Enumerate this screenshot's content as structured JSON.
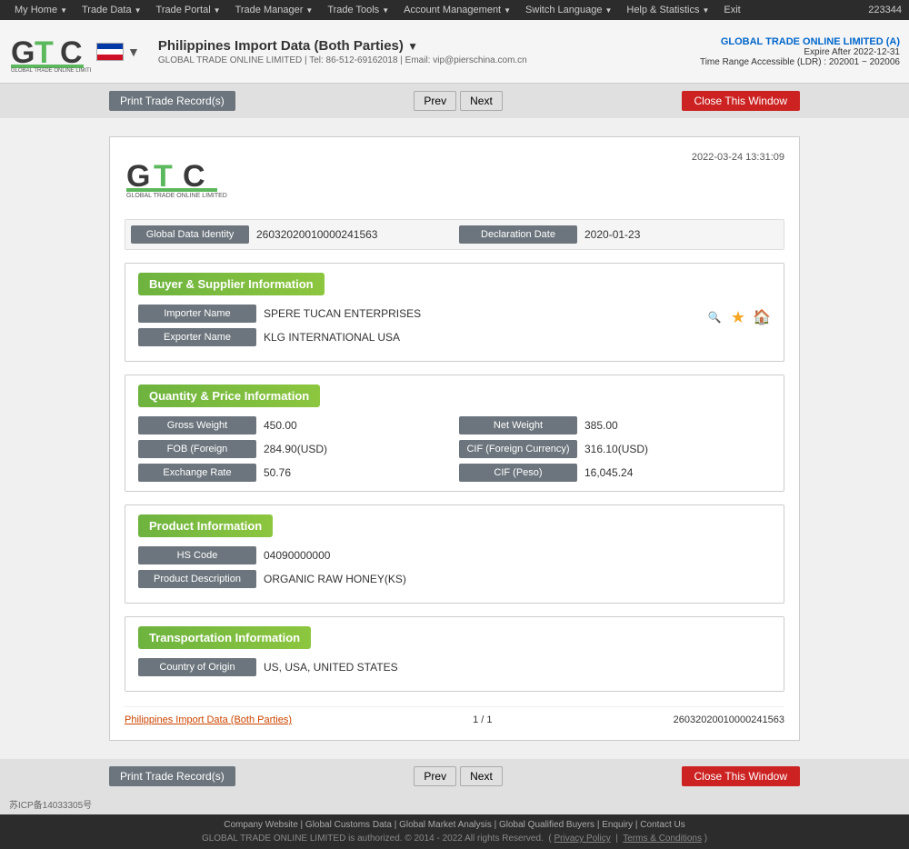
{
  "topnav": {
    "items": [
      "My Home",
      "Trade Data",
      "Trade Portal",
      "Trade Manager",
      "Trade Tools",
      "Account Management",
      "Switch Language",
      "Help & Statistics",
      "Exit"
    ],
    "user_id": "223344"
  },
  "header": {
    "title": "Philippines Import Data (Both Parties)",
    "subtitle": "GLOBAL TRADE ONLINE LIMITED | Tel: 86-512-69162018 | Email: vip@pierschina.com.cn",
    "company": "GLOBAL TRADE ONLINE LIMITED (A)",
    "expire": "Expire After 2022-12-31",
    "range": "Time Range Accessible (LDR) : 202001 ~ 202006"
  },
  "toolbar": {
    "print_label": "Print Trade Record(s)",
    "prev_label": "Prev",
    "next_label": "Next",
    "close_label": "Close This Window"
  },
  "card": {
    "datetime": "2022-03-24 13:31:09",
    "global_data_identity_label": "Global Data Identity",
    "global_data_identity_value": "26032020010000241563",
    "declaration_date_label": "Declaration Date",
    "declaration_date_value": "2020-01-23",
    "sections": {
      "buyer_supplier": {
        "title": "Buyer & Supplier Information",
        "importer_label": "Importer Name",
        "importer_value": "SPERE TUCAN ENTERPRISES",
        "exporter_label": "Exporter Name",
        "exporter_value": "KLG INTERNATIONAL USA"
      },
      "quantity_price": {
        "title": "Quantity & Price Information",
        "gross_weight_label": "Gross Weight",
        "gross_weight_value": "450.00",
        "net_weight_label": "Net Weight",
        "net_weight_value": "385.00",
        "fob_label": "FOB (Foreign",
        "fob_value": "284.90(USD)",
        "cif_foreign_label": "CIF (Foreign Currency)",
        "cif_foreign_value": "316.10(USD)",
        "exchange_rate_label": "Exchange Rate",
        "exchange_rate_value": "50.76",
        "cif_peso_label": "CIF (Peso)",
        "cif_peso_value": "16,045.24"
      },
      "product": {
        "title": "Product Information",
        "hs_code_label": "HS Code",
        "hs_code_value": "04090000000",
        "product_desc_label": "Product Description",
        "product_desc_value": "ORGANIC RAW HONEY(KS)"
      },
      "transportation": {
        "title": "Transportation Information",
        "country_origin_label": "Country of Origin",
        "country_origin_value": "US, USA, UNITED STATES"
      }
    },
    "footer": {
      "link_text": "Philippines Import Data (Both Parties)",
      "page": "1 / 1",
      "record_id": "26032020010000241563"
    }
  },
  "bottom_toolbar": {
    "print_label": "Print Trade Record(s)",
    "prev_label": "Prev",
    "next_label": "Next",
    "close_label": "Close This Window"
  },
  "footer": {
    "links": [
      "Company Website",
      "Global Customs Data",
      "Global Market Analysis",
      "Global Qualified Buyers",
      "Enquiry",
      "Contact Us"
    ],
    "copyright": "GLOBAL TRADE ONLINE LIMITED is authorized. © 2014 - 2022 All rights Reserved.",
    "privacy": "Privacy Policy",
    "terms": "Terms & Conditions",
    "icp": "苏ICP备14033305号"
  }
}
